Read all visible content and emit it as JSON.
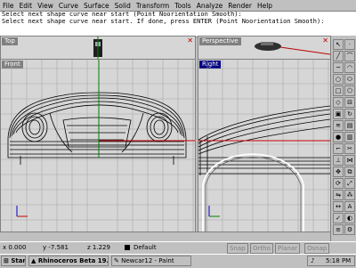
{
  "menu": [
    "File",
    "Edit",
    "View",
    "Curve",
    "Surface",
    "Solid",
    "Transform",
    "Tools",
    "Analyze",
    "Render",
    "Help"
  ],
  "command_lines": [
    "Select next shape curve near start (Point Noorientation Smooth):",
    "Select next shape curve near start. If done, press ENTER (Point Noorientation Smooth):"
  ],
  "viewports": {
    "top": {
      "title": "Top"
    },
    "perspective": {
      "title": "Perspective"
    },
    "front": {
      "title": "Front"
    },
    "right": {
      "title": "Right"
    }
  },
  "status": {
    "x": "x  0.000",
    "y": "y  -7.581",
    "z": "z  1.229",
    "layer": "Default",
    "snap": "Snap",
    "ortho": "Ortho",
    "planar": "Planar",
    "osnap": "Osnap"
  },
  "taskbar": {
    "start": "Start",
    "items": [
      "Rhinoceros Beta 19...",
      "Newcar12 - Paint"
    ],
    "clock": "5:18 PM"
  },
  "colors": {
    "active_title": "#000080",
    "inactive_title": "#808080",
    "grid": "#9e9e9e",
    "axis_x": "#c00000",
    "axis_y": "#008000"
  }
}
